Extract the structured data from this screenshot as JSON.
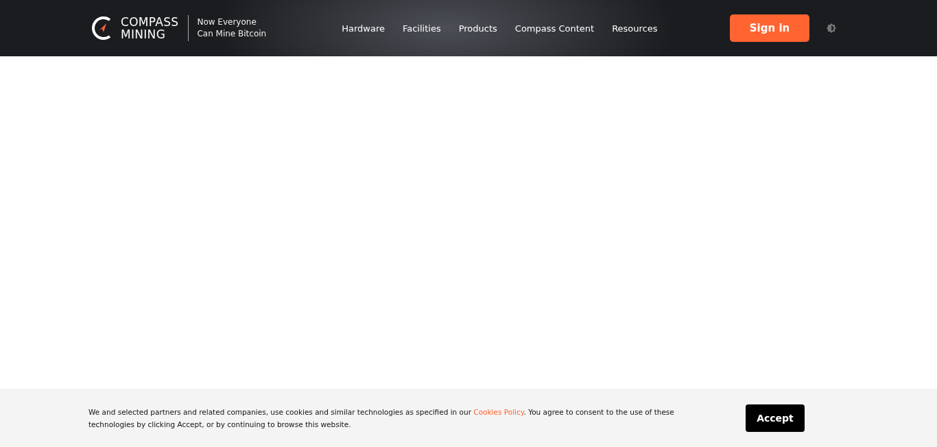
{
  "header": {
    "logo": {
      "line_1": "COMPASS",
      "line_2": "MINING"
    },
    "tagline": {
      "line_1": "Now Everyone",
      "line_2": "Can Mine Bitcoin"
    },
    "nav": [
      {
        "label": "Hardware"
      },
      {
        "label": "Facilities"
      },
      {
        "label": "Products"
      },
      {
        "label": "Compass Content"
      },
      {
        "label": "Resources"
      }
    ],
    "sign_in": "Sign in"
  },
  "cookie_banner": {
    "text_before": "We and selected partners and related companies, use cookies and similar technologies as specified in our ",
    "link": "Cookies Policy",
    "text_after": ". You agree to consent to the use of these technologies by clicking Accept, or by continuing to browse this website.",
    "button": "Accept"
  }
}
